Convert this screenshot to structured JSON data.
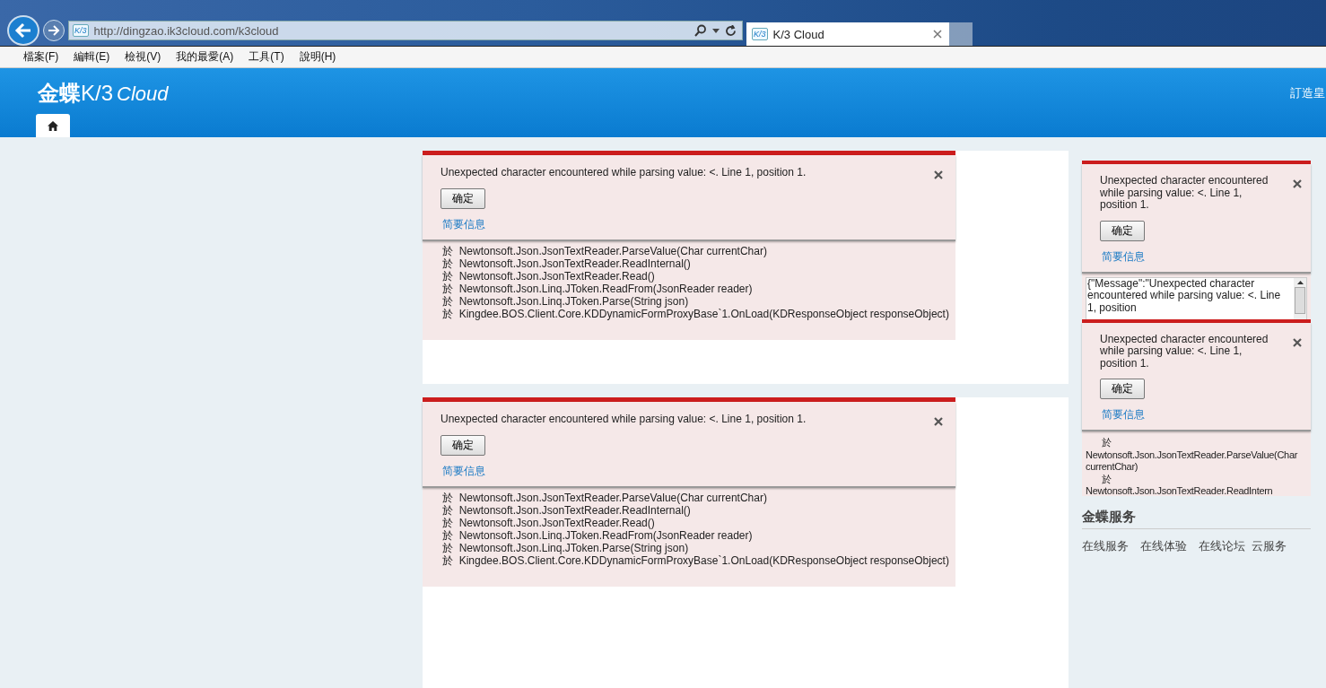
{
  "browser": {
    "address": "http://dingzao.ik3cloud.com/k3cloud",
    "tab": {
      "title": "K/3 Cloud",
      "favicon": "K/3"
    },
    "address_favicon": "K/3"
  },
  "menu": [
    "檔案(F)",
    "編輯(E)",
    "檢視(V)",
    "我的最愛(A)",
    "工具(T)",
    "說明(H)"
  ],
  "header": {
    "logo_cn": "金蝶",
    "logo_k3": "K/3",
    "logo_cloud": "Cloud",
    "user_text": "訂造皇"
  },
  "main_dialogs": [
    {
      "message": "Unexpected character encountered while parsing value: <. Line 1, position 1.",
      "button": "确定",
      "link": "简要信息",
      "kind": "trace",
      "details": [
        "於  Newtonsoft.Json.JsonTextReader.ParseValue(Char currentChar)",
        "於  Newtonsoft.Json.JsonTextReader.ReadInternal()",
        "於  Newtonsoft.Json.JsonTextReader.Read()",
        "於  Newtonsoft.Json.Linq.JToken.ReadFrom(JsonReader reader)",
        "於  Newtonsoft.Json.Linq.JToken.Parse(String json)",
        "於  Kingdee.BOS.Client.Core.KDDynamicFormProxyBase`1.OnLoad(KDResponseObject responseObject)"
      ]
    },
    {
      "message": "Unexpected character encountered while parsing value: <. Line 1, position 1.",
      "button": "确定",
      "link": "简要信息",
      "kind": "trace",
      "details": [
        "於  Newtonsoft.Json.JsonTextReader.ParseValue(Char currentChar)",
        "於  Newtonsoft.Json.JsonTextReader.ReadInternal()",
        "於  Newtonsoft.Json.JsonTextReader.Read()",
        "於  Newtonsoft.Json.Linq.JToken.ReadFrom(JsonReader reader)",
        "於  Newtonsoft.Json.Linq.JToken.Parse(String json)",
        "於  Kingdee.BOS.Client.Core.KDDynamicFormProxyBase`1.OnLoad(KDResponseObject responseObject)"
      ]
    }
  ],
  "side_dialogs": [
    {
      "message": "Unexpected character encountered while parsing value: <. Line 1, position 1.",
      "button": "确定",
      "link": "简要信息",
      "kind": "json",
      "details": [
        "{\"Message\":\"Unexpected character encountered while parsing value: <. Line 1, position"
      ]
    },
    {
      "message": "Unexpected character encountered while parsing value: <. Line 1, position 1.",
      "button": "确定",
      "link": "简要信息",
      "kind": "trace",
      "details": [
        "於",
        "Newtonsoft.Json.JsonTextReader.ParseValue(Char currentChar)",
        "於",
        "Newtonsoft.Json.JsonTextReader.ReadIntern"
      ]
    }
  ],
  "service": {
    "title": "金蝶服务",
    "links": [
      "在线服务",
      "在线体验",
      "在线论坛",
      "云服务"
    ]
  }
}
